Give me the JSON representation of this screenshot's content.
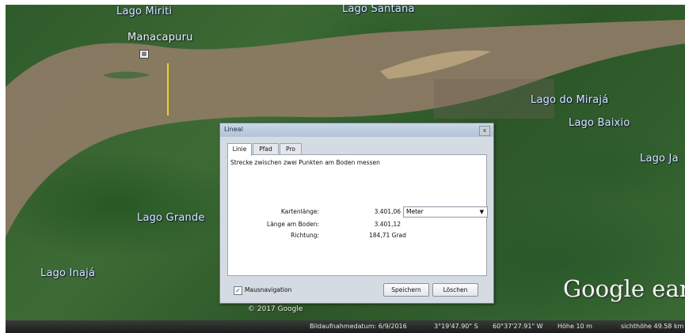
{
  "map": {
    "places": {
      "lago_miriti": "Lago Miriti",
      "lago_santana": "Lago Santana",
      "manacapuru": "Manacapuru",
      "lago_do_miraja": "Lago do Mirajá",
      "lago_baixio": "Lago Baixio",
      "lago_ja": "Lago Ja",
      "lago_grande": "Lago Grande",
      "lago_inaja": "Lago Inajá"
    },
    "logo": "Google eart",
    "copyright": "© 2017 Google"
  },
  "status_bar": {
    "imagery_date": "Bildaufnahmedatum: 6/9/2016",
    "latitude": "3°19'47.90\" S",
    "longitude": "60°37'27.91\" W",
    "elevation": "Höhe   10 m",
    "eye_altitude": "sichthöhe  49.58 km"
  },
  "dialog": {
    "title": "Lineal",
    "close_glyph": "x",
    "tabs": [
      "Linie",
      "Pfad",
      "Pro"
    ],
    "description": "Strecke zwischen zwei Punkten am Boden messen",
    "map_length_label": "Kartenlänge:",
    "map_length_value": "3.401,06",
    "unit": "Meter",
    "ground_length_label": "Länge am Boden:",
    "ground_length_value": "3.401,12",
    "heading_label": "Richtung:",
    "heading_value": "184,71 Grad",
    "mouse_nav_label": "Mausnavigation",
    "mouse_nav_checked": true,
    "save_label": "Speichern",
    "clear_label": "Löschen"
  }
}
